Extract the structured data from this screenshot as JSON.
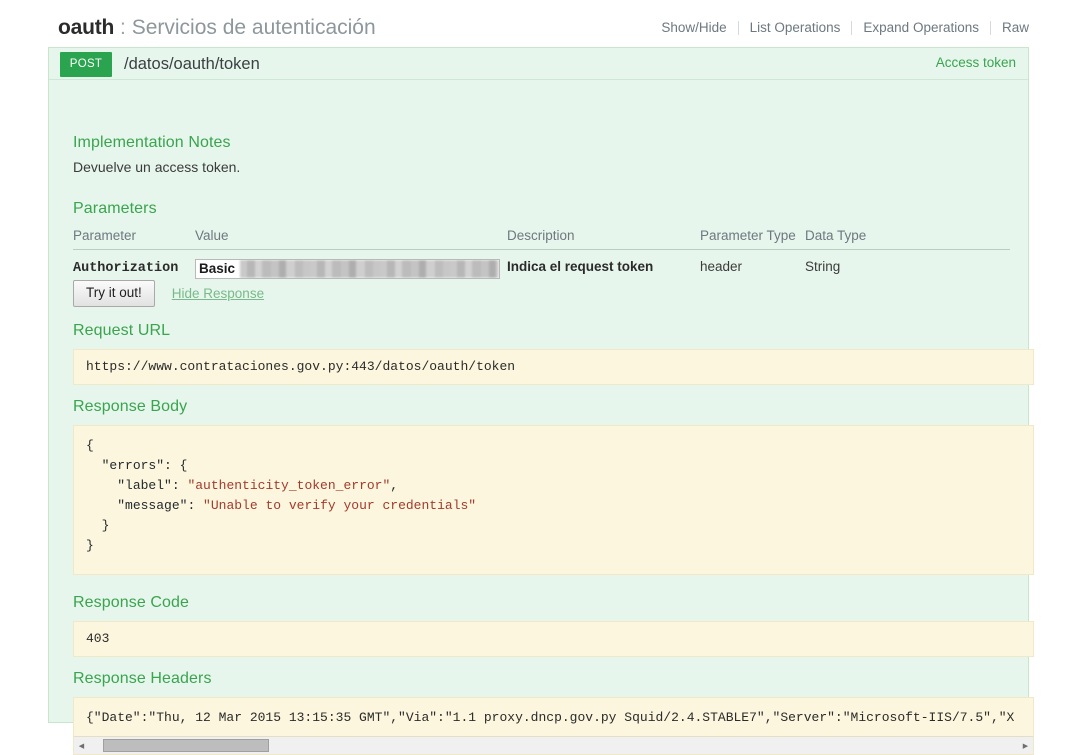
{
  "resource": {
    "name": "oauth",
    "separator": ":",
    "description": "Servicios de autenticación",
    "options": [
      {
        "label": "Show/Hide"
      },
      {
        "label": "List Operations"
      },
      {
        "label": "Expand Operations"
      },
      {
        "label": "Raw"
      }
    ]
  },
  "operation": {
    "method": "POST",
    "path": "/datos/oauth/token",
    "access_label": "Access token",
    "method_color": "#2aa44f",
    "notes": {
      "heading": "Implementation Notes",
      "body": "Devuelve un access token."
    },
    "parameters": {
      "heading": "Parameters",
      "columns": [
        "Parameter",
        "Value",
        "Description",
        "Parameter Type",
        "Data Type"
      ],
      "rows": [
        {
          "name": "Authorization",
          "value_typed": "Basic",
          "value_redacted": true,
          "description": "Indica el request token",
          "parameter_type": "header",
          "data_type": "String"
        }
      ]
    },
    "actions": {
      "submit_label": "Try it out!",
      "toggle_response_label": "Hide Response"
    },
    "response": {
      "request_url_heading": "Request URL",
      "request_url": "https://www.contrataciones.gov.py:443/datos/oauth/token",
      "body_heading": "Response Body",
      "body": {
        "line1": "{",
        "line2_key": "\"errors\"",
        "line2_rest": ": {",
        "line3_key": "\"label\"",
        "line3_val": "\"authenticity_token_error\"",
        "line3_tail": ",",
        "line4_key": "\"message\"",
        "line4_val": "\"Unable to verify your credentials\"",
        "line5": "}",
        "line6": "}"
      },
      "code_heading": "Response Code",
      "code": "403",
      "headers_heading": "Response Headers",
      "headers_text": "{\"Date\":\"Thu, 12 Mar 2015 13:15:35 GMT\",\"Via\":\"1.1 proxy.dncp.gov.py Squid/2.4.STABLE7\",\"Server\":\"Microsoft-IIS/7.5\",\"X",
      "scroll_left_arrow": "◀",
      "scroll_right_arrow": "▶"
    }
  },
  "theme": {
    "panel_bg": "#e7f6ec",
    "panel_border": "#c8e6c9",
    "accent_green": "#3aa44f",
    "code_bg": "#fbf6dd",
    "json_string_color": "#a33b2d"
  }
}
